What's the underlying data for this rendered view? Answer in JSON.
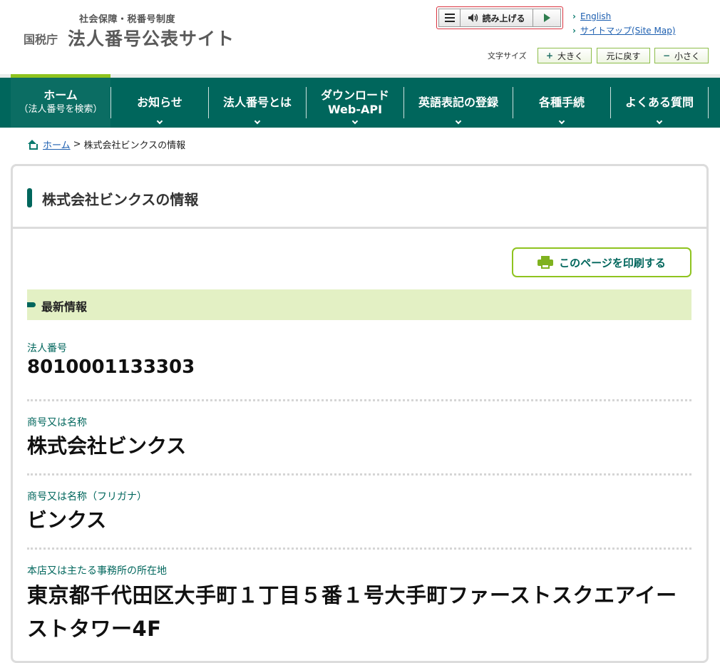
{
  "header": {
    "logo_sub": "社会保障・税番号制度",
    "logo_agency": "国税庁",
    "logo_main": "法人番号公表サイト",
    "speech": {
      "read_label": "読み上げる"
    },
    "links": [
      "English",
      "サイトマップ(Site Map)"
    ],
    "fontsize": {
      "label": "文字サイズ",
      "larger": "大きく",
      "reset": "元に戻す",
      "smaller": "小さく"
    }
  },
  "nav": {
    "items": [
      {
        "label": "ホーム",
        "sub": "（法人番号を検索）"
      },
      {
        "label": "お知らせ"
      },
      {
        "label": "法人番号とは"
      },
      {
        "label": "ダウンロード",
        "sub": "Web-API"
      },
      {
        "label": "英語表記の登録"
      },
      {
        "label": "各種手続"
      },
      {
        "label": "よくある質問"
      }
    ]
  },
  "breadcrumb": {
    "home": "ホーム",
    "separator": ">",
    "current": "株式会社ビンクスの情報"
  },
  "panel": {
    "title": "株式会社ビンクスの情報",
    "print_label": "このページを印刷する",
    "section_title": "最新情報",
    "fields": [
      {
        "label": "法人番号",
        "value": "8010001133303"
      },
      {
        "label": "商号又は名称",
        "value": "株式会社ビンクス"
      },
      {
        "label": "商号又は名称（フリガナ）",
        "value": "ビンクス"
      },
      {
        "label": "本店又は主たる事務所の所在地",
        "value": "東京都千代田区大手町１丁目５番１号大手町ファーストスクエアイーストタワー4F"
      }
    ]
  },
  "colors": {
    "brand_green": "#00665c",
    "accent_lime": "#8fc31f",
    "band_bg": "#e3f0c4",
    "link": "#1d5fb0"
  }
}
